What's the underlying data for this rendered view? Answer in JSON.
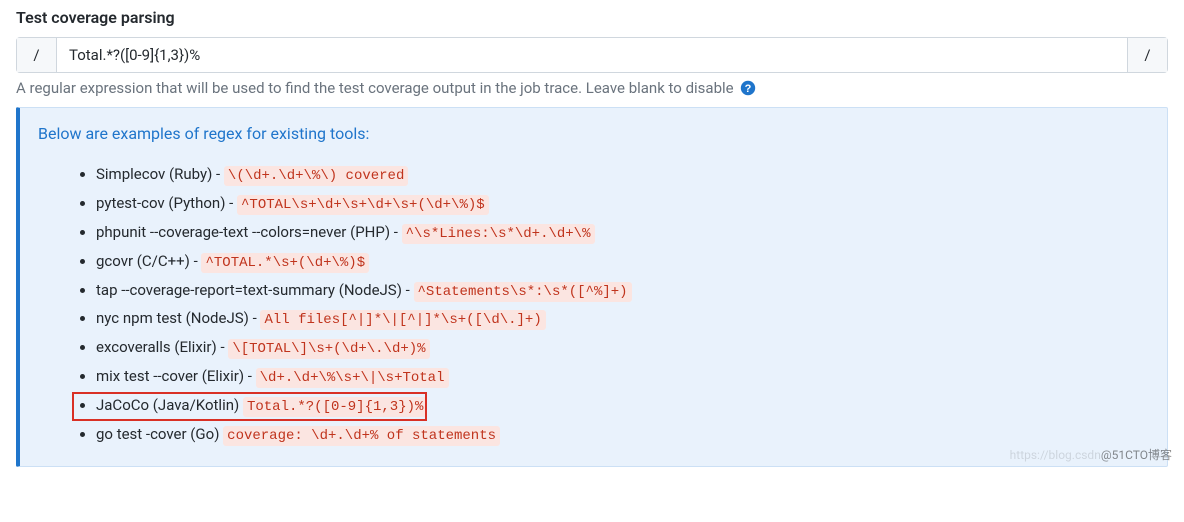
{
  "section": {
    "title": "Test coverage parsing",
    "slash": "/",
    "input_value": "Total.*?([0-9]{1,3})%",
    "help_text": "A regular expression that will be used to find the test coverage output in the job trace. Leave blank to disable"
  },
  "info": {
    "lead": "Below are examples of regex for existing tools:",
    "items": [
      {
        "label": "Simplecov (Ruby)",
        "sep": " - ",
        "regex": "\\(\\d+.\\d+\\%\\) covered"
      },
      {
        "label": "pytest-cov (Python)",
        "sep": " - ",
        "regex": "^TOTAL\\s+\\d+\\s+\\d+\\s+(\\d+\\%)$"
      },
      {
        "label": "phpunit --coverage-text --colors=never (PHP)",
        "sep": " - ",
        "regex": "^\\s*Lines:\\s*\\d+.\\d+\\%"
      },
      {
        "label": "gcovr (C/C++)",
        "sep": " - ",
        "regex": "^TOTAL.*\\s+(\\d+\\%)$"
      },
      {
        "label": "tap --coverage-report=text-summary (NodeJS)",
        "sep": " - ",
        "regex": "^Statements\\s*:\\s*([^%]+)"
      },
      {
        "label": "nyc npm test (NodeJS)",
        "sep": " - ",
        "regex": "All files[^|]*\\|[^|]*\\s+([\\d\\.]+)"
      },
      {
        "label": "excoveralls (Elixir)",
        "sep": " - ",
        "regex": "\\[TOTAL\\]\\s+(\\d+\\.\\d+)%"
      },
      {
        "label": "mix test --cover (Elixir)",
        "sep": " - ",
        "regex": "\\d+.\\d+\\%\\s+\\|\\s+Total"
      },
      {
        "label": "JaCoCo (Java/Kotlin)",
        "sep": " ",
        "regex": "Total.*?([0-9]{1,3})%",
        "highlighted": true
      },
      {
        "label": "go test -cover (Go)",
        "sep": " ",
        "regex": "coverage: \\d+.\\d+% of statements"
      }
    ]
  },
  "watermark": {
    "faint": "https://blog.csdn",
    "dark": "@51CTO博客"
  }
}
